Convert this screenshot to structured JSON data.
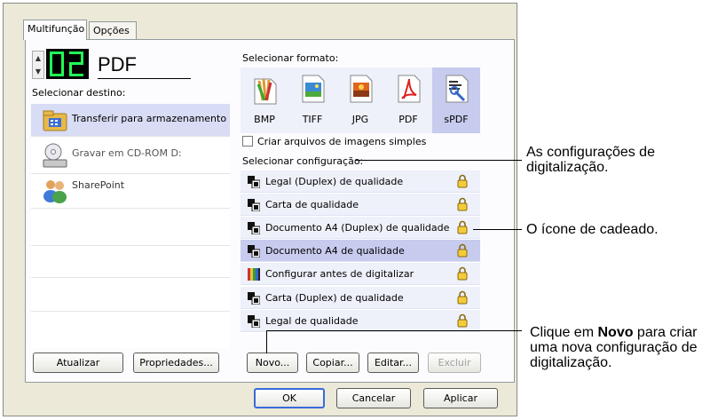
{
  "tabs": [
    {
      "label": "Multifunção"
    },
    {
      "label": "Opções"
    }
  ],
  "display": {
    "number": "02",
    "format": "PDF"
  },
  "destination": {
    "label": "Selecionar destino:",
    "items": [
      {
        "label": "Transferir para armazenamento",
        "icon": "folder-transfer-icon",
        "selected": true
      },
      {
        "label": "Gravar em CD-ROM  D:",
        "icon": "cd-drive-icon"
      },
      {
        "label": "SharePoint",
        "icon": "sharepoint-people-icon"
      }
    ]
  },
  "format": {
    "label": "Selecionar formato:",
    "items": [
      {
        "label": "BMP",
        "icon": "bmp-paint-icon"
      },
      {
        "label": "TIFF",
        "icon": "tiff-image-icon"
      },
      {
        "label": "JPG",
        "icon": "jpg-image-icon"
      },
      {
        "label": "PDF",
        "icon": "pdf-icon"
      },
      {
        "label": "sPDF",
        "icon": "searchable-pdf-icon",
        "selected": true
      }
    ],
    "checkbox_label": "Criar arquivos de imagens simples"
  },
  "configuration": {
    "label": "Selecionar configuração:",
    "items": [
      {
        "label": "Legal (Duplex) de qualidade",
        "locked": true
      },
      {
        "label": "Carta de qualidade",
        "locked": true
      },
      {
        "label": "Documento A4 (Duplex) de qualidade",
        "locked": true
      },
      {
        "label": "Documento A4 de qualidade",
        "locked": true,
        "selected": true
      },
      {
        "label": "Configurar antes de digitalizar",
        "locked": true,
        "icon": "configure-color-icon"
      },
      {
        "label": "Carta (Duplex) de qualidade",
        "locked": true
      },
      {
        "label": "Legal de qualidade",
        "locked": true
      }
    ]
  },
  "buttons": {
    "update": "Atualizar",
    "properties": "Propriedades...",
    "new": "Novo...",
    "copy": "Copiar...",
    "edit": "Editar...",
    "delete": "Excluir",
    "ok": "OK",
    "cancel": "Cancelar",
    "apply": "Aplicar"
  },
  "callouts": {
    "settings": "As configurações de digitalização.",
    "lock": "O ícone de cadeado.",
    "new_prefix": "Clique em ",
    "new_bold": "Novo",
    "new_suffix": " para criar uma nova configuração de digitalização."
  },
  "colors": {
    "lcd_digit": "#22ff55",
    "selection": "#c7cbee",
    "accent": "#3a6bd9"
  }
}
